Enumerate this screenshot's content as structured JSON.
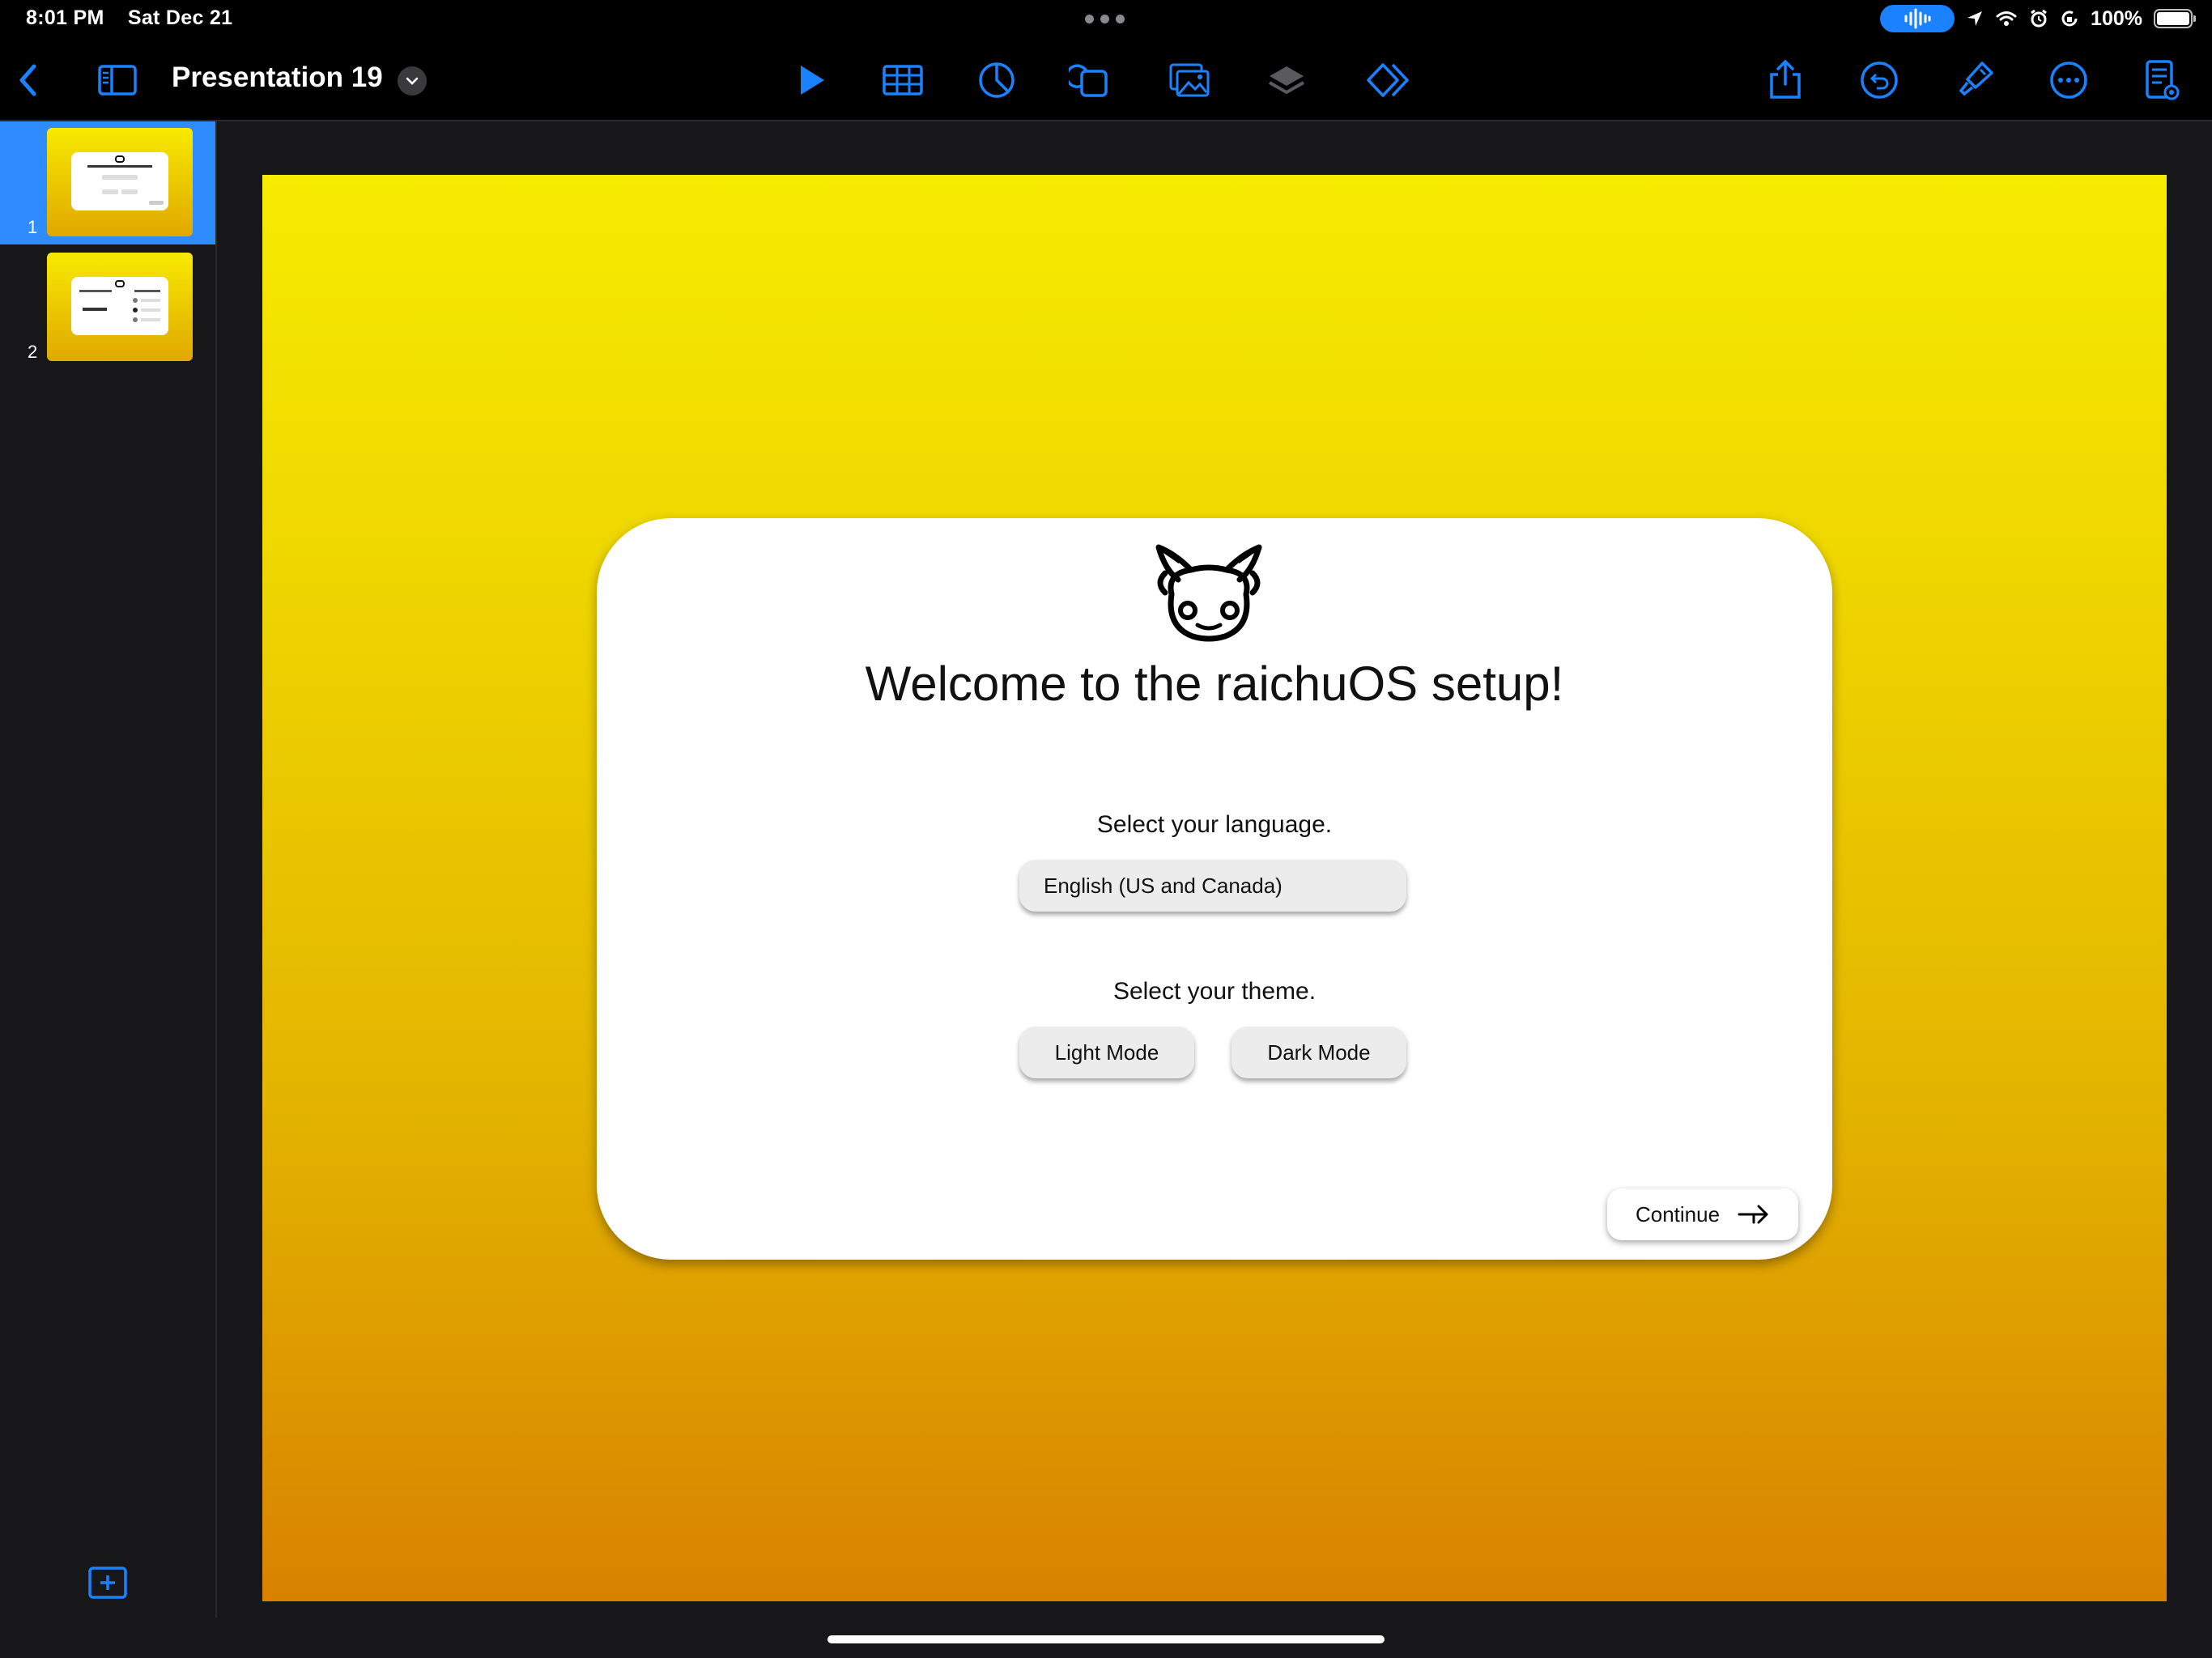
{
  "status_bar": {
    "time": "8:01 PM",
    "date": "Sat Dec 21",
    "battery": "100%",
    "icons": [
      "mic-waveform-icon",
      "location-arrow-icon",
      "wifi-icon",
      "alarm-icon",
      "screen-lock-rotation-icon",
      "battery-icon"
    ]
  },
  "toolbar": {
    "document_title": "Presentation 19",
    "icons": [
      "back-chevron-icon",
      "sidebar-toggle-icon",
      "title-chevron-down-icon",
      "play-icon",
      "table-icon",
      "chart-icon",
      "shape-icon",
      "media-icon",
      "layers-icon",
      "animate-icon",
      "share-icon",
      "undo-icon",
      "format-brush-icon",
      "more-icon",
      "presenter-notes-icon"
    ],
    "accent_color": "#1a82ff"
  },
  "sidebar": {
    "slides": [
      {
        "number": "1",
        "selected": true
      },
      {
        "number": "2",
        "selected": false
      }
    ]
  },
  "slide": {
    "gradient_top": "#f6ec00",
    "gradient_bottom": "#d88200",
    "card": {
      "title": "Welcome to the raichuOS setup!",
      "language_label": "Select your language.",
      "language_value": "English (US and Canada)",
      "theme_label": "Select your theme.",
      "theme_options": [
        "Light Mode",
        "Dark Mode"
      ],
      "continue_label": "Continue",
      "mascot": "raichu-head-icon"
    }
  }
}
